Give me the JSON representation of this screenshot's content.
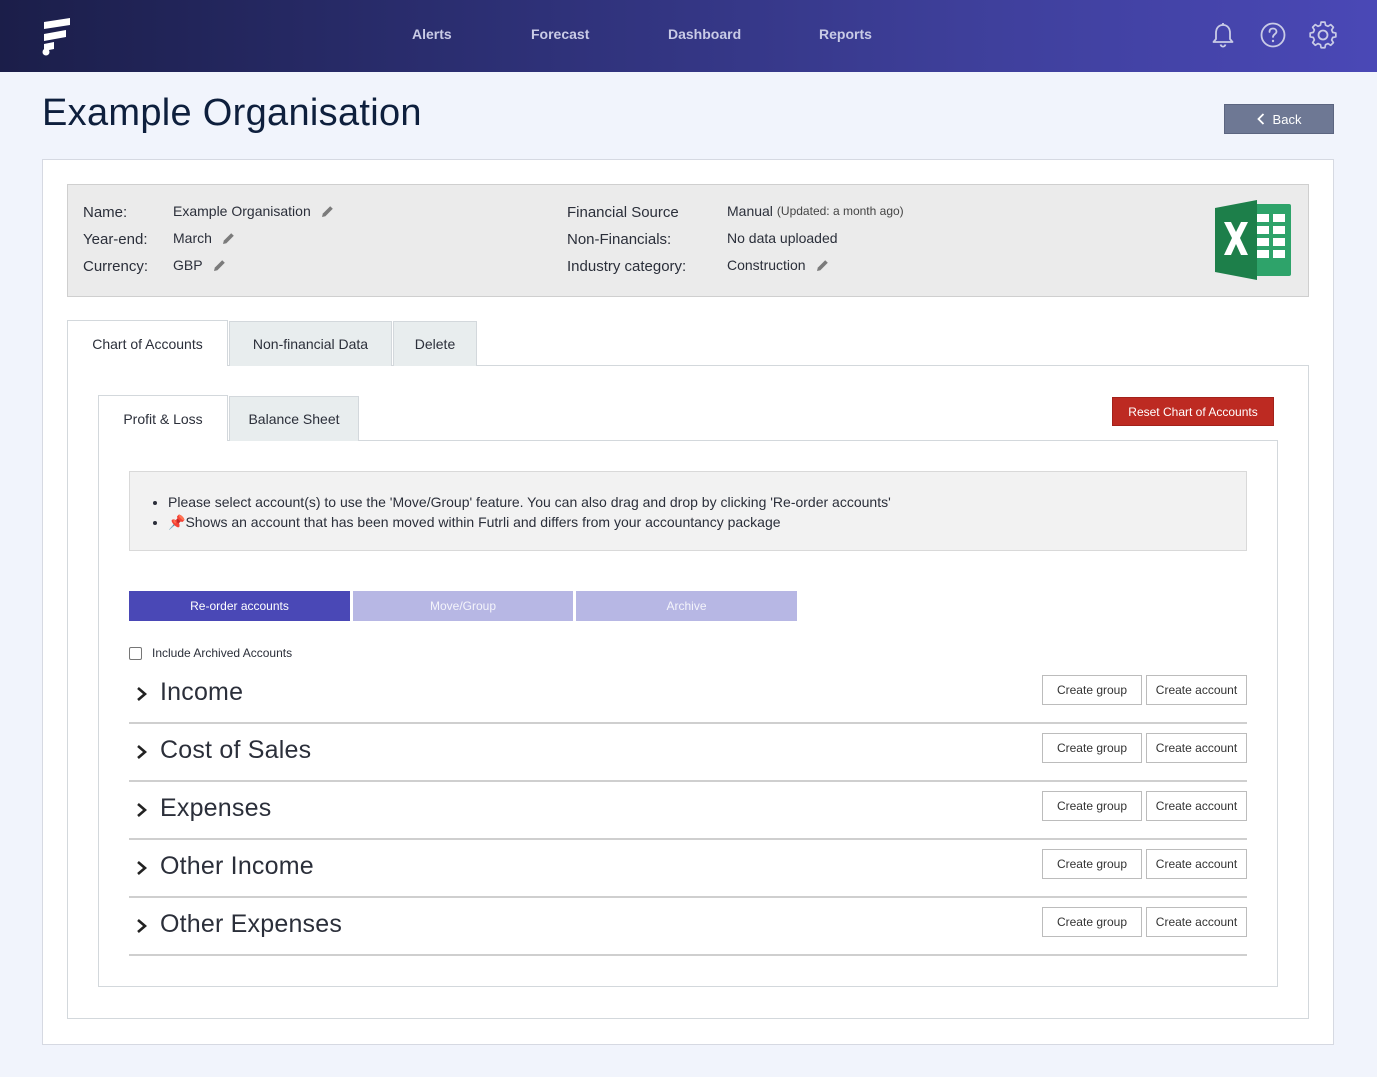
{
  "nav": {
    "items": [
      "Alerts",
      "Forecast",
      "Dashboard",
      "Reports"
    ],
    "icons": [
      "bell-icon",
      "help-icon",
      "gear-icon"
    ]
  },
  "page": {
    "title": "Example Organisation",
    "back_label": "Back"
  },
  "info": {
    "name_label": "Name:",
    "name_value": "Example Organisation",
    "yearend_label": "Year-end:",
    "yearend_value": "March",
    "currency_label": "Currency:",
    "currency_value": "GBP",
    "source_label": "Financial Source",
    "source_value": "Manual",
    "source_updated": "(Updated: a month ago)",
    "nonfin_label": "Non-Financials:",
    "nonfin_value": "No data uploaded",
    "industry_label": "Industry category:",
    "industry_value": "Construction"
  },
  "tabs": {
    "main": [
      "Chart of Accounts",
      "Non-financial Data",
      "Delete"
    ],
    "sub": [
      "Profit & Loss",
      "Balance Sheet"
    ]
  },
  "reset_label": "Reset Chart of Accounts",
  "notice": {
    "line1": "Please select account(s) to use the 'Move/Group' feature. You can also drag and drop by clicking 'Re-order accounts'",
    "line2": "Shows an account that has been moved within Futrli and differs from your accountancy package"
  },
  "actions": {
    "reorder": "Re-order accounts",
    "move": "Move/Group",
    "archive": "Archive"
  },
  "include_archived_label": "Include Archived Accounts",
  "section_buttons": {
    "create_group": "Create group",
    "create_account": "Create account"
  },
  "sections": [
    "Income",
    "Cost of Sales",
    "Expenses",
    "Other Income",
    "Other Expenses"
  ],
  "colors": {
    "nav_start": "#1b1e49",
    "nav_end": "#4a48b6",
    "primary": "#4a48b6",
    "danger": "#bd2a22",
    "excel_green": "#1d7f4a"
  }
}
